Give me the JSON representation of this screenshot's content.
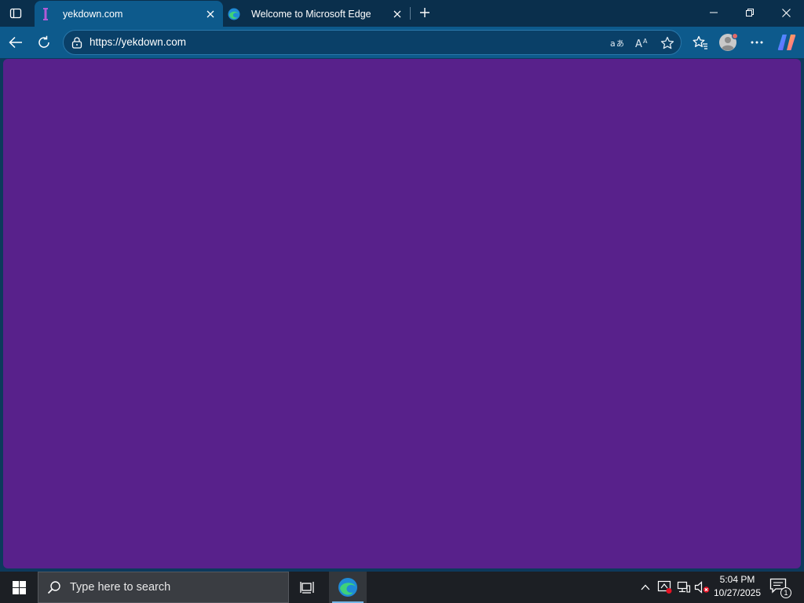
{
  "browser": {
    "tabs": [
      {
        "title": "yekdown.com",
        "favicon": "yekdown-favicon",
        "active": true
      },
      {
        "title": "Welcome to Microsoft Edge",
        "favicon": "edge-icon",
        "active": false
      }
    ],
    "address": {
      "url": "https://yekdown.com"
    },
    "colors": {
      "tabstrip": "#0a2f4c",
      "toolbar": "#0d5a8c",
      "page_background": "#58218b",
      "favicon_accent": "#b05bd6"
    }
  },
  "taskbar": {
    "search_placeholder": "Type here to search",
    "time": "5:04 PM",
    "date": "10/27/2025",
    "notification_count": "1"
  }
}
